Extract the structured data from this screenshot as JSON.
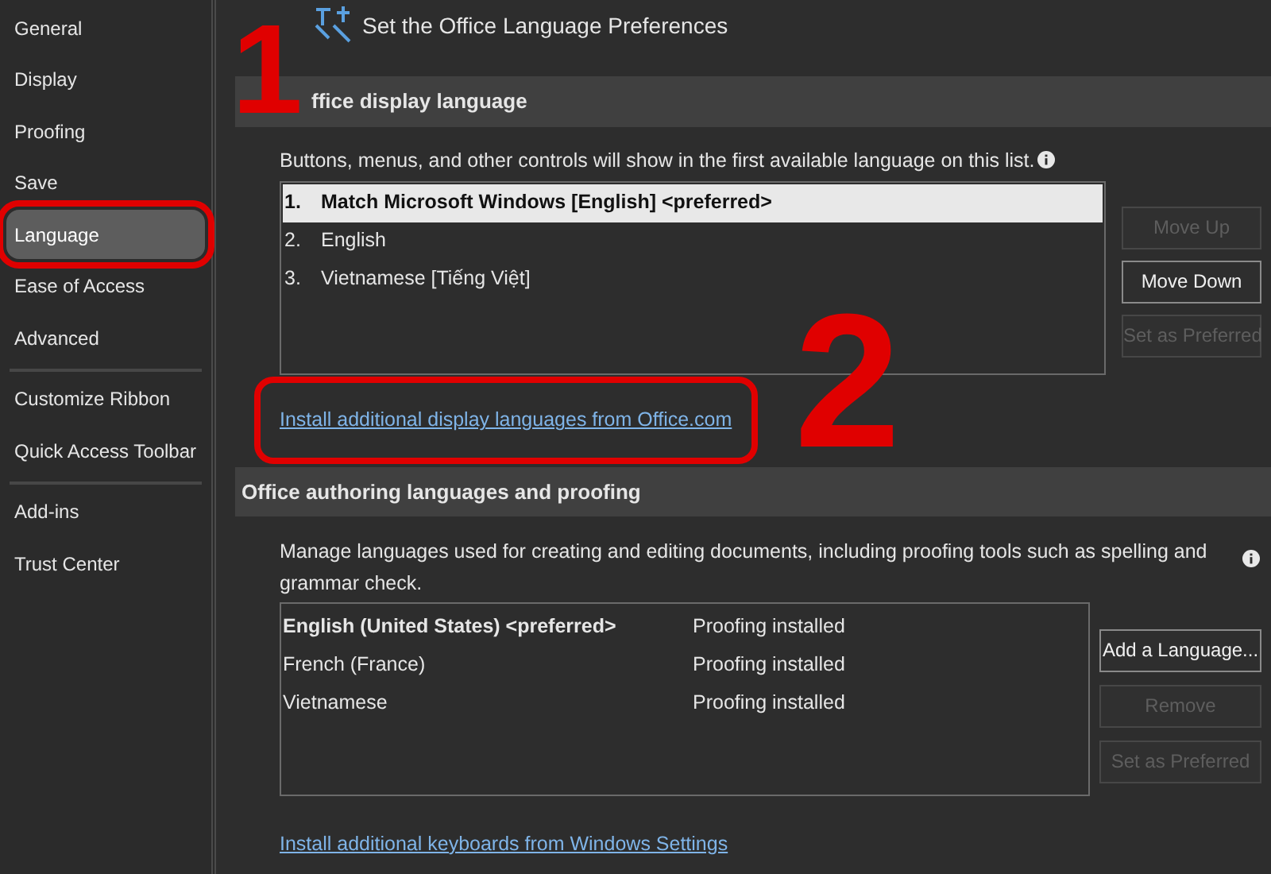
{
  "sidebar": {
    "groups": [
      {
        "items": [
          {
            "label": "General",
            "selected": false,
            "highlighted": false
          },
          {
            "label": "Display",
            "selected": false,
            "highlighted": false
          },
          {
            "label": "Proofing",
            "selected": false,
            "highlighted": false
          },
          {
            "label": "Save",
            "selected": false,
            "highlighted": false
          },
          {
            "label": "Language",
            "selected": true,
            "highlighted": true
          },
          {
            "label": "Ease of Access",
            "selected": false,
            "highlighted": false
          },
          {
            "label": "Advanced",
            "selected": false,
            "highlighted": false
          }
        ]
      },
      {
        "items": [
          {
            "label": "Customize Ribbon",
            "selected": false,
            "highlighted": false
          },
          {
            "label": "Quick Access Toolbar",
            "selected": false,
            "highlighted": false
          }
        ]
      },
      {
        "items": [
          {
            "label": "Add-ins",
            "selected": false,
            "highlighted": false
          },
          {
            "label": "Trust Center",
            "selected": false,
            "highlighted": false
          }
        ]
      }
    ]
  },
  "page_title": "Set the Office Language Preferences",
  "display_section": {
    "heading": "ffice display language",
    "description": "Buttons, menus, and other controls will show in the first available language on this list.",
    "languages": [
      {
        "number": "1.",
        "name": "Match Microsoft Windows [English] <preferred>",
        "selected": true
      },
      {
        "number": "2.",
        "name": "English",
        "selected": false
      },
      {
        "number": "3.",
        "name": "Vietnamese [Tiếng Việt]",
        "selected": false
      }
    ],
    "buttons": [
      {
        "label": "Move Up",
        "disabled": true
      },
      {
        "label": "Move Down",
        "disabled": false
      },
      {
        "label": "Set as Preferred",
        "disabled": true
      }
    ],
    "link": {
      "text": "Install additional display languages from Office.com",
      "highlighted": true
    }
  },
  "authoring_section": {
    "heading": "Office authoring languages and proofing",
    "description": "Manage languages used for creating and editing documents, including proofing tools such as spelling and grammar check.",
    "languages": [
      {
        "name": "English (United States) <preferred>",
        "status": "Proofing installed",
        "preferred": true
      },
      {
        "name": "French (France)",
        "status": "Proofing installed",
        "preferred": false
      },
      {
        "name": "Vietnamese",
        "status": "Proofing installed",
        "preferred": false
      }
    ],
    "buttons": [
      {
        "label": "Add a Language...",
        "disabled": false
      },
      {
        "label": "Remove",
        "disabled": true
      },
      {
        "label": "Set as Preferred",
        "disabled": true
      }
    ],
    "link": {
      "text": "Install additional keyboards from Windows Settings",
      "highlighted": false
    }
  },
  "annotations": [
    {
      "text": "1"
    },
    {
      "text": "2"
    }
  ]
}
